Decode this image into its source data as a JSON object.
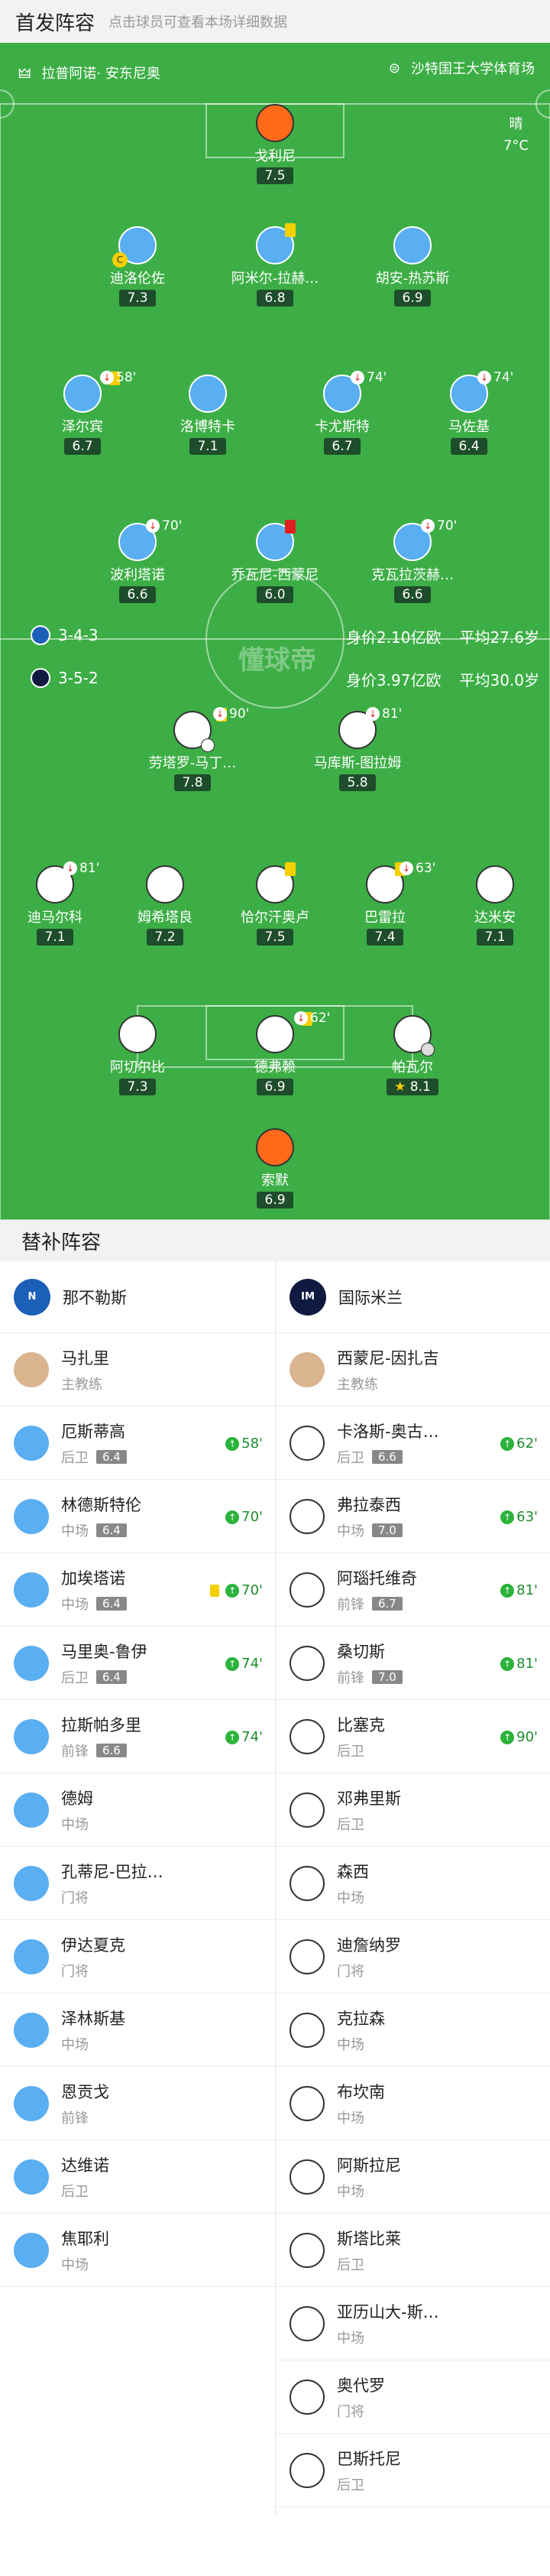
{
  "header": {
    "title": "首发阵容",
    "subtitle": "点击球员可查看本场详细数据"
  },
  "venue": {
    "referee": "拉普阿诺· 安东尼奥",
    "stadium": "沙特国王大学体育场"
  },
  "weather": {
    "condition": "晴",
    "temperature": "7°C"
  },
  "watermark": "懂球帝",
  "napoli": {
    "formation": "3-4-3",
    "value": "身价2.10亿欧",
    "age": "平均27.6岁",
    "players": [
      {
        "name": "戈利尼",
        "rating": "7.5"
      },
      {
        "name": "迪洛伦佐",
        "rating": "7.3",
        "captain": "C"
      },
      {
        "name": "阿米尔-拉赫…",
        "rating": "6.8"
      },
      {
        "name": "胡安-热苏斯",
        "rating": "6.9"
      },
      {
        "name": "泽尔宾",
        "rating": "6.7",
        "sub": "58'"
      },
      {
        "name": "洛博特卡",
        "rating": "7.1"
      },
      {
        "name": "卡尤斯特",
        "rating": "6.7",
        "sub": "74'"
      },
      {
        "name": "马佐基",
        "rating": "6.4",
        "sub": "74'"
      },
      {
        "name": "波利塔诺",
        "rating": "6.6",
        "sub": "70'"
      },
      {
        "name": "乔瓦尼-西蒙尼",
        "rating": "6.0"
      },
      {
        "name": "克瓦拉茨赫…",
        "rating": "6.6",
        "sub": "70'"
      }
    ]
  },
  "inter": {
    "formation": "3-5-2",
    "value": "身价3.97亿欧",
    "age": "平均30.0岁",
    "players": [
      {
        "name": "劳塔罗-马丁…",
        "rating": "7.8",
        "sub": "90'"
      },
      {
        "name": "马库斯-图拉姆",
        "rating": "5.8",
        "sub": "81'"
      },
      {
        "name": "迪马尔科",
        "rating": "7.1",
        "sub": "81'"
      },
      {
        "name": "姆希塔良",
        "rating": "7.2"
      },
      {
        "name": "恰尔汗奥卢",
        "rating": "7.5"
      },
      {
        "name": "巴雷拉",
        "rating": "7.4",
        "sub": "63'"
      },
      {
        "name": "达米安",
        "rating": "7.1"
      },
      {
        "name": "阿切尔比",
        "rating": "7.3"
      },
      {
        "name": "德弗赖",
        "rating": "6.9",
        "sub": "62'"
      },
      {
        "name": "帕瓦尔",
        "rating": "8.1"
      },
      {
        "name": "索默",
        "rating": "6.9"
      }
    ]
  },
  "bench": {
    "title": "替补阵容",
    "left": {
      "team": "那不勒斯",
      "logo_text": "N",
      "coach": {
        "name": "马扎里",
        "role": "主教练"
      },
      "players": [
        {
          "name": "厄斯蒂高",
          "pos": "后卫",
          "rating": "6.4",
          "sub": "58'"
        },
        {
          "name": "林德斯特伦",
          "pos": "中场",
          "rating": "6.4",
          "sub": "70'"
        },
        {
          "name": "加埃塔诺",
          "pos": "中场",
          "rating": "6.4",
          "sub": "70'",
          "yellow": true
        },
        {
          "name": "马里奥-鲁伊",
          "pos": "后卫",
          "rating": "6.4",
          "sub": "74'"
        },
        {
          "name": "拉斯帕多里",
          "pos": "前锋",
          "rating": "6.6",
          "sub": "74'"
        },
        {
          "name": "德姆",
          "pos": "中场"
        },
        {
          "name": "孔蒂尼-巴拉…",
          "pos": "门将"
        },
        {
          "name": "伊达夏克",
          "pos": "门将"
        },
        {
          "name": "泽林斯基",
          "pos": "中场"
        },
        {
          "name": "恩贡戈",
          "pos": "前锋"
        },
        {
          "name": "达维诺",
          "pos": "后卫"
        },
        {
          "name": "焦耶利",
          "pos": "中场"
        }
      ]
    },
    "right": {
      "team": "国际米兰",
      "logo_text": "IM",
      "coach": {
        "name": "西蒙尼-因扎吉",
        "role": "主教练"
      },
      "players": [
        {
          "name": "卡洛斯-奥古…",
          "pos": "后卫",
          "rating": "6.6",
          "sub": "62'"
        },
        {
          "name": "弗拉泰西",
          "pos": "中场",
          "rating": "7.0",
          "sub": "63'"
        },
        {
          "name": "阿瑙托维奇",
          "pos": "前锋",
          "rating": "6.7",
          "sub": "81'"
        },
        {
          "name": "桑切斯",
          "pos": "前锋",
          "rating": "7.0",
          "sub": "81'"
        },
        {
          "name": "比塞克",
          "pos": "后卫",
          "sub": "90'"
        },
        {
          "name": "邓弗里斯",
          "pos": "后卫"
        },
        {
          "name": "森西",
          "pos": "中场"
        },
        {
          "name": "迪詹纳罗",
          "pos": "门将"
        },
        {
          "name": "克拉森",
          "pos": "中场"
        },
        {
          "name": "布坎南",
          "pos": "中场"
        },
        {
          "name": "阿斯拉尼",
          "pos": "中场"
        },
        {
          "name": "斯塔比莱",
          "pos": "后卫"
        },
        {
          "name": "亚历山大-斯…",
          "pos": "中场"
        },
        {
          "name": "奥代罗",
          "pos": "门将"
        },
        {
          "name": "巴斯托尼",
          "pos": "后卫"
        }
      ]
    }
  }
}
